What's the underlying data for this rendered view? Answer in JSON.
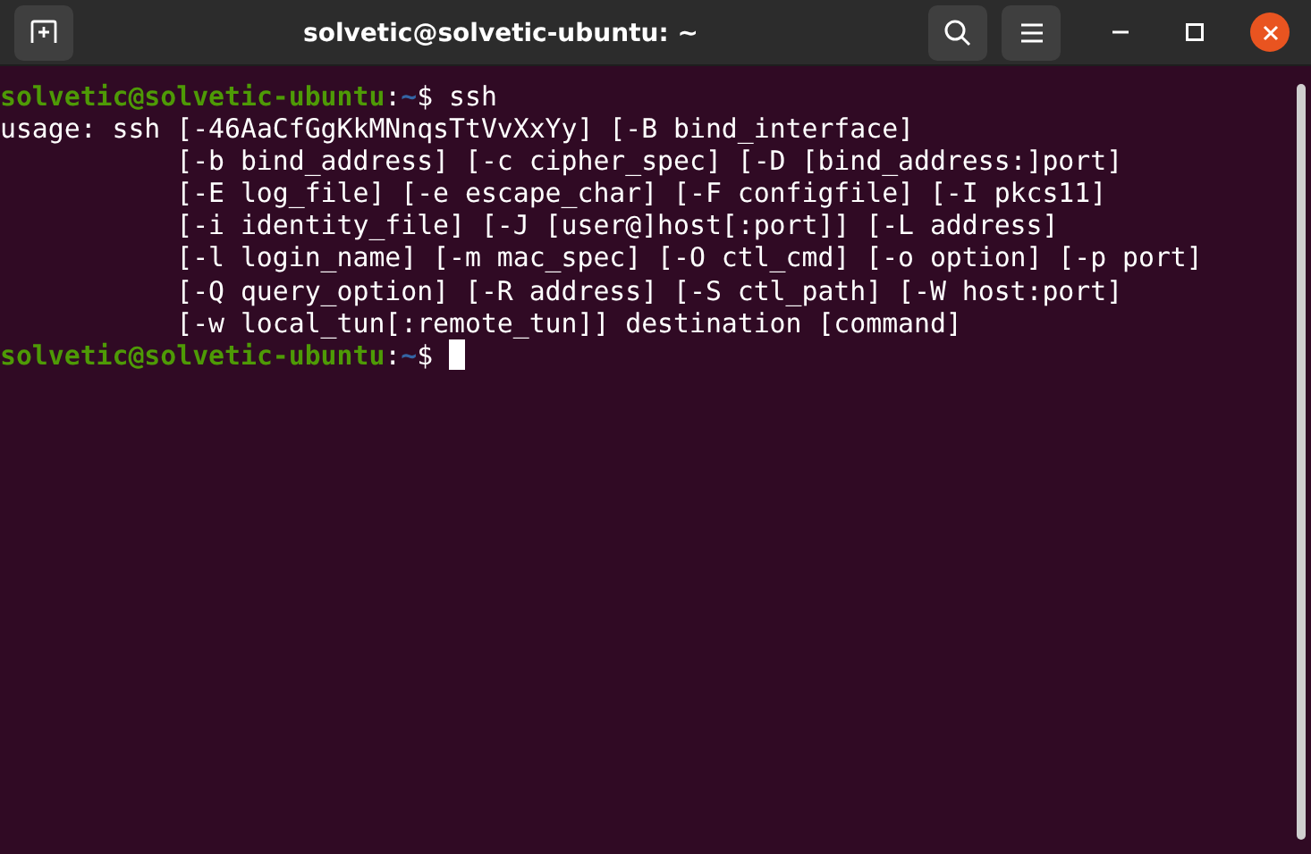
{
  "window": {
    "title": "solvetic@solvetic-ubuntu: ~"
  },
  "terminal": {
    "lines": [
      {
        "kind": "prompt",
        "user": "solvetic@solvetic-ubuntu",
        "separator": ":",
        "path": "~",
        "symbol": "$",
        "command": "ssh",
        "cursor": false
      },
      {
        "kind": "output",
        "text": "usage: ssh [-46AaCfGgKkMNnqsTtVvXxYy] [-B bind_interface]"
      },
      {
        "kind": "continuation",
        "text": "[-b bind_address] [-c cipher_spec] [-D [bind_address:]port]"
      },
      {
        "kind": "continuation",
        "text": "[-E log_file] [-e escape_char] [-F configfile] [-I pkcs11]"
      },
      {
        "kind": "continuation",
        "text": "[-i identity_file] [-J [user@]host[:port]] [-L address]"
      },
      {
        "kind": "continuation",
        "text": "[-l login_name] [-m mac_spec] [-O ctl_cmd] [-o option] [-p port]"
      },
      {
        "kind": "continuation",
        "text": "[-Q query_option] [-R address] [-S ctl_path] [-W host:port]"
      },
      {
        "kind": "continuation",
        "text": "[-w local_tun[:remote_tun]] destination [command]"
      },
      {
        "kind": "prompt",
        "user": "solvetic@solvetic-ubuntu",
        "separator": ":",
        "path": "~",
        "symbol": "$",
        "cursor": true
      }
    ]
  }
}
